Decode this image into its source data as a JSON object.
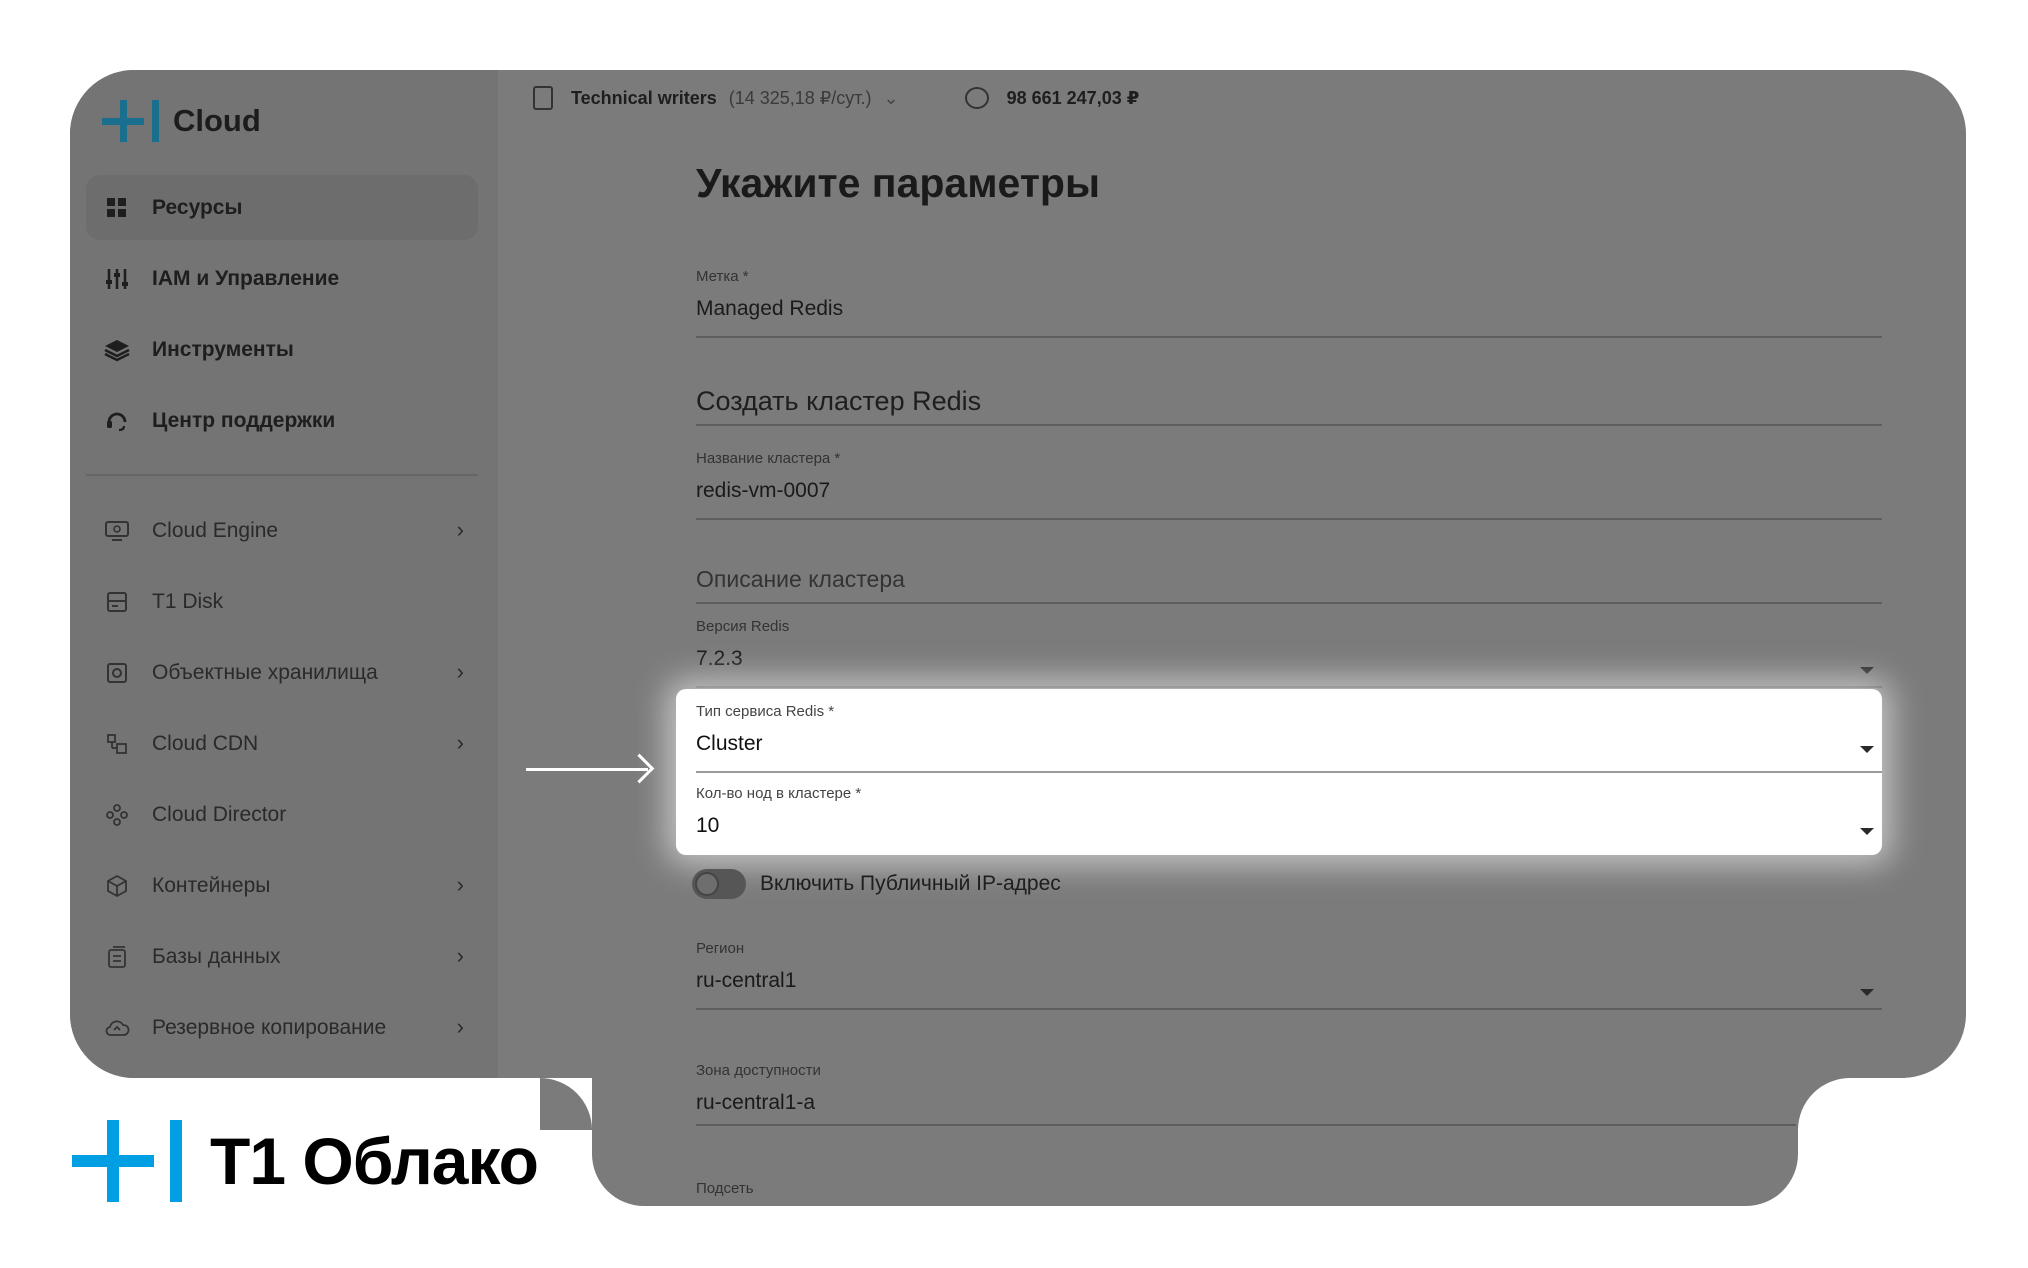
{
  "brand": {
    "name": "Cloud"
  },
  "nav": {
    "items": [
      {
        "label": "Ресурсы",
        "icon": "grid-icon",
        "active": true
      },
      {
        "label": "IAM и Управление",
        "icon": "sliders-icon"
      },
      {
        "label": "Инструменты",
        "icon": "layers-icon"
      },
      {
        "label": "Центр поддержки",
        "icon": "headset-icon"
      }
    ]
  },
  "services": {
    "items": [
      {
        "label": "Cloud Engine",
        "icon": "monitor-icon",
        "has_children": true
      },
      {
        "label": "T1 Disk",
        "icon": "disk-icon",
        "has_children": false
      },
      {
        "label": "Объектные хранилища",
        "icon": "storage-icon",
        "has_children": true
      },
      {
        "label": "Cloud CDN",
        "icon": "cdn-icon",
        "has_children": true
      },
      {
        "label": "Cloud Director",
        "icon": "director-icon",
        "has_children": false
      },
      {
        "label": "Контейнеры",
        "icon": "cube-icon",
        "has_children": true
      },
      {
        "label": "Базы данных",
        "icon": "database-icon",
        "has_children": true
      },
      {
        "label": "Резервное копирование",
        "icon": "cloud-backup-icon",
        "has_children": true
      }
    ]
  },
  "topbar": {
    "org": "Technical writers",
    "rate": "(14 325,18 ₽/сут.)",
    "balance": "98 661 247,03 ₽"
  },
  "form": {
    "title": "Укажите параметры",
    "label_field": {
      "label": "Метка *",
      "value": "Managed Redis"
    },
    "section_title": "Создать кластер Redis",
    "cluster_name": {
      "label": "Название кластера *",
      "value": "redis-vm-0007"
    },
    "description": {
      "placeholder": "Описание кластера"
    },
    "redis_version": {
      "label": "Версия Redis",
      "value": "7.2.3"
    },
    "service_type": {
      "label": "Тип сервиса Redis *",
      "value": "Cluster"
    },
    "node_count": {
      "label": "Кол-во нод в кластере *",
      "value": "10"
    },
    "public_ip": {
      "label": "Включить Публичный IP-адрес",
      "enabled": false
    },
    "region": {
      "label": "Регион",
      "value": "ru-central1"
    },
    "zone": {
      "label": "Зона доступности",
      "value": "ru-central1-a"
    },
    "subnet": {
      "label": "Подсеть"
    }
  },
  "footer_logo": {
    "text": "T1 Облако"
  },
  "colors": {
    "brand_blue": "#009fe3",
    "overlay_grey": "#7b7b7b"
  }
}
